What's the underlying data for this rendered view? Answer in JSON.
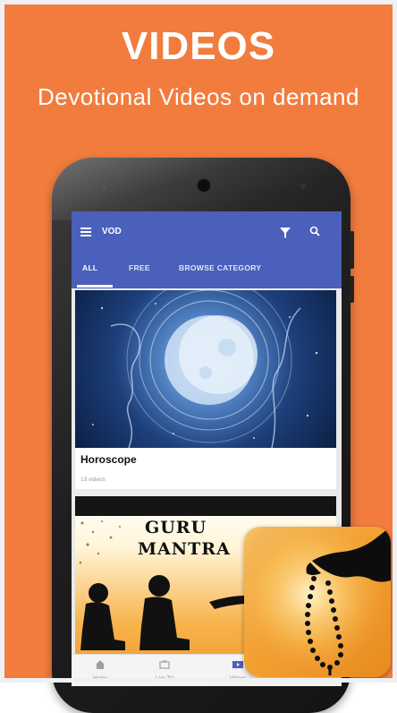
{
  "banner": {
    "title": "VIDEOS",
    "subtitle": "Devotional Videos on demand"
  },
  "colors": {
    "background": "#f17c3e",
    "app_bar": "#4a60bb"
  },
  "app_bar": {
    "title": "VOD",
    "icons": [
      "menu-icon",
      "filter-icon",
      "search-icon"
    ]
  },
  "tabs": [
    {
      "label": "ALL",
      "selected": true
    },
    {
      "label": "FREE",
      "selected": false
    },
    {
      "label": "BROWSE CATEGORY",
      "selected": false
    }
  ],
  "cards": [
    {
      "title": "Horoscope",
      "subtitle": "13 videos",
      "image": "zodiac-moon-image"
    },
    {
      "image": "guru-mantra-image",
      "image_text": [
        "GURU",
        "MANTRA"
      ]
    }
  ],
  "bottom_nav": [
    {
      "label": "Home",
      "icon": "home-icon"
    },
    {
      "label": "Live TV",
      "icon": "live-tv-icon"
    },
    {
      "label": "Videos",
      "icon": "video-icon"
    }
  ],
  "promo_icon": "prayer-beads-icon"
}
